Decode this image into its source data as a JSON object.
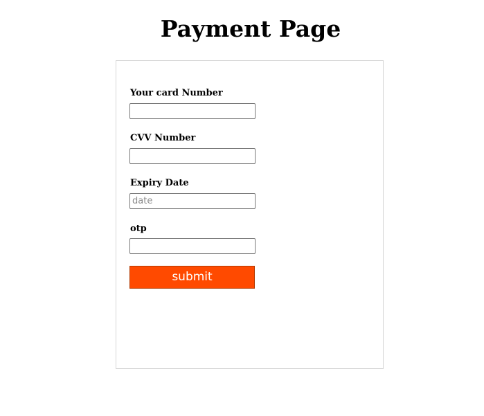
{
  "page": {
    "title": "Payment Page"
  },
  "form": {
    "card_number": {
      "label": "Your card Number",
      "value": "",
      "placeholder": ""
    },
    "cvv": {
      "label": "CVV Number",
      "value": "",
      "placeholder": ""
    },
    "expiry": {
      "label": "Expiry Date",
      "value": "",
      "placeholder": "date"
    },
    "otp": {
      "label": "otp",
      "value": "",
      "placeholder": ""
    },
    "submit_label": "submit"
  },
  "colors": {
    "submit_background": "#ff4a00",
    "submit_text": "#ffffff",
    "card_border": "#d6d6d6"
  }
}
